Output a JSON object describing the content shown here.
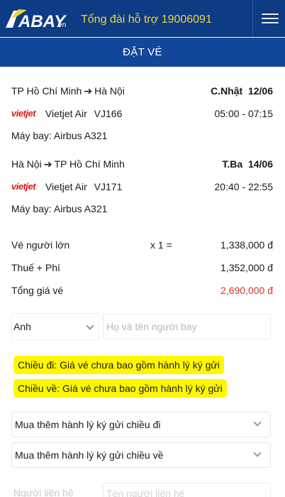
{
  "header": {
    "brand": "ABAY",
    "brand_suffix": ".vn",
    "hotline": "Tổng đài hỗ trợ 19006091",
    "menu_icon": "hamburger-menu-icon"
  },
  "page_title": "ĐẶT VÉ",
  "outbound": {
    "from": "TP Hồ Chí Minh",
    "to": "Hà Nội",
    "day_date": "C.Nhật  12/06",
    "airline_logo": "vietjet",
    "airline": "Vietjet Air",
    "flight_no": "VJ166",
    "time": "05:00 - 07:15",
    "aircraft": "Máy bay: Airbus A321"
  },
  "inbound": {
    "from": "Hà Nội",
    "to": "TP Hồ Chí Minh",
    "day_date": "T.Ba  14/06",
    "airline_logo": "vietjet",
    "airline": "Vietjet Air",
    "flight_no": "VJ171",
    "time": "20:40 - 22:55",
    "aircraft": "Máy bay: Airbus A321"
  },
  "pricing": {
    "adult_label": "Vé người lớn",
    "adult_qty": "x 1 =",
    "adult_price": "1,338,000 đ",
    "tax_label": "Thuế + Phí",
    "tax_price": "1,352,000 đ",
    "total_label": "Tổng giá vé",
    "total_price": "2,690,000 đ",
    "total_color": "#d93025"
  },
  "passenger": {
    "title_selected": "Anh",
    "name_placeholder": "Họ và tên người bay"
  },
  "notes": {
    "outbound": "Chiều đi:  Giá vé chưa bao gồm hành lý ký gửi",
    "inbound": "Chiều về:  Giá vé chưa bao gồm hành lý ký gửi",
    "highlight_color": "#fff700"
  },
  "baggage": {
    "outbound": "Mua thêm hành lý ký gửi chiều đi",
    "inbound": "Mua thêm hành lý ký gửi chiều về"
  },
  "contact": {
    "label": "Người liên hệ",
    "placeholder": "Tên người liên hệ"
  },
  "colors": {
    "header_bg": "#0d3b84",
    "title_bg": "#12479a",
    "hotline": "#f4d03f",
    "airline_red": "#e3171b"
  }
}
